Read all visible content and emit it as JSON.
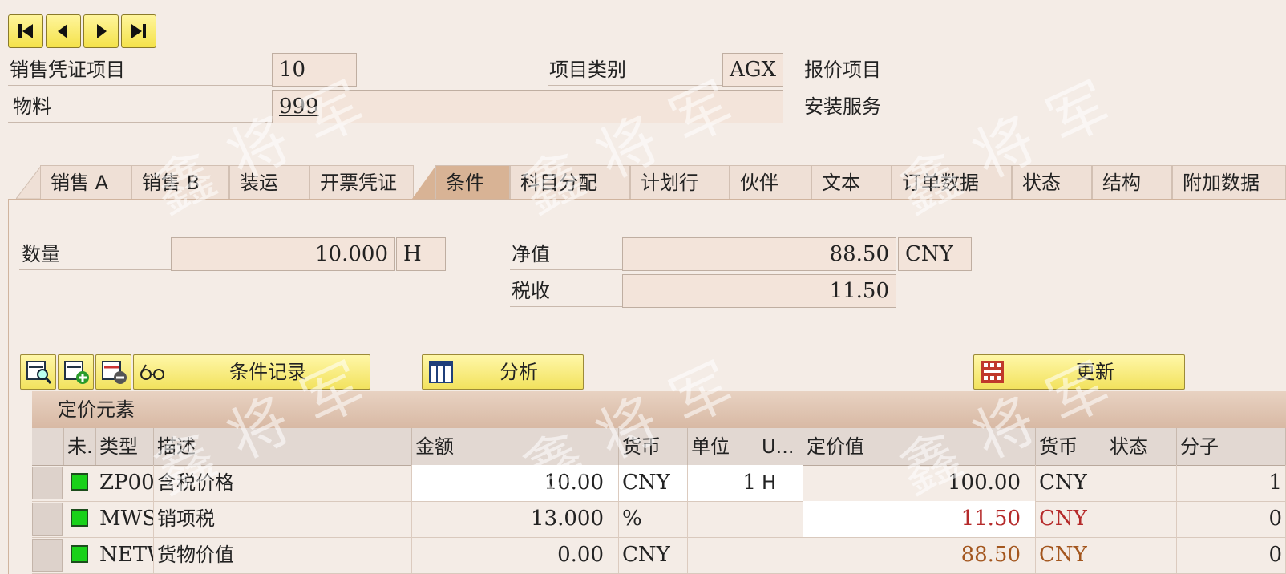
{
  "nav_icons": [
    "first-page-icon",
    "previous-page-icon",
    "next-page-icon",
    "last-page-icon"
  ],
  "header": {
    "item_label": "销售凭证项目",
    "item_value": "10",
    "category_label": "项目类别",
    "category_value": "AGX",
    "category_desc": "报价项目",
    "material_label": "物料",
    "material_value": "999",
    "material_desc": "安装服务"
  },
  "tabs": [
    "销售 A",
    "销售 B",
    "装运",
    "开票凭证",
    "条件",
    "科目分配",
    "计划行",
    "伙伴",
    "文本",
    "订单数据",
    "状态",
    "结构",
    "附加数据"
  ],
  "active_tab": "条件",
  "summary": {
    "qty_label": "数量",
    "qty_value": "10.000",
    "qty_unit": "H",
    "net_label": "净值",
    "net_value": "88.50",
    "net_currency": "CNY",
    "tax_label": "税收",
    "tax_value": "11.50"
  },
  "toolbar": {
    "cond_record_label": "条件记录",
    "analysis_label": "分析",
    "update_label": "更新"
  },
  "table": {
    "group_title": "定价元素",
    "columns": [
      "未.",
      "类型",
      "描述",
      "金额",
      "货币",
      "单位",
      "U...",
      "定价值",
      "货币",
      "状态",
      "分子"
    ],
    "rows": [
      {
        "type": "ZP00",
        "desc": "含税价格",
        "amount": "10.00",
        "currency": "CNY",
        "unit": "1",
        "uom": "H",
        "cond_value": "100.00",
        "cond_currency": "CNY",
        "status": "",
        "numerator": "1"
      },
      {
        "type": "MWSI",
        "desc": "销项税",
        "amount": "13.000",
        "currency": "%",
        "unit": "",
        "uom": "",
        "cond_value": "11.50",
        "cond_currency": "CNY",
        "status": "",
        "numerator": "0"
      },
      {
        "type": "NETW",
        "desc": "货物价值",
        "amount": "0.00",
        "currency": "CNY",
        "unit": "",
        "uom": "",
        "cond_value": "88.50",
        "cond_currency": "CNY",
        "status": "",
        "numerator": "0"
      }
    ]
  },
  "colors": {
    "background": "#f4ece6",
    "button_yellow": "#f2e25e",
    "active_tab": "#d8b395",
    "status_green": "#19d119",
    "tax_red": "#b52a2a",
    "net_brown": "#a3561e"
  },
  "watermark": "鑫将军"
}
